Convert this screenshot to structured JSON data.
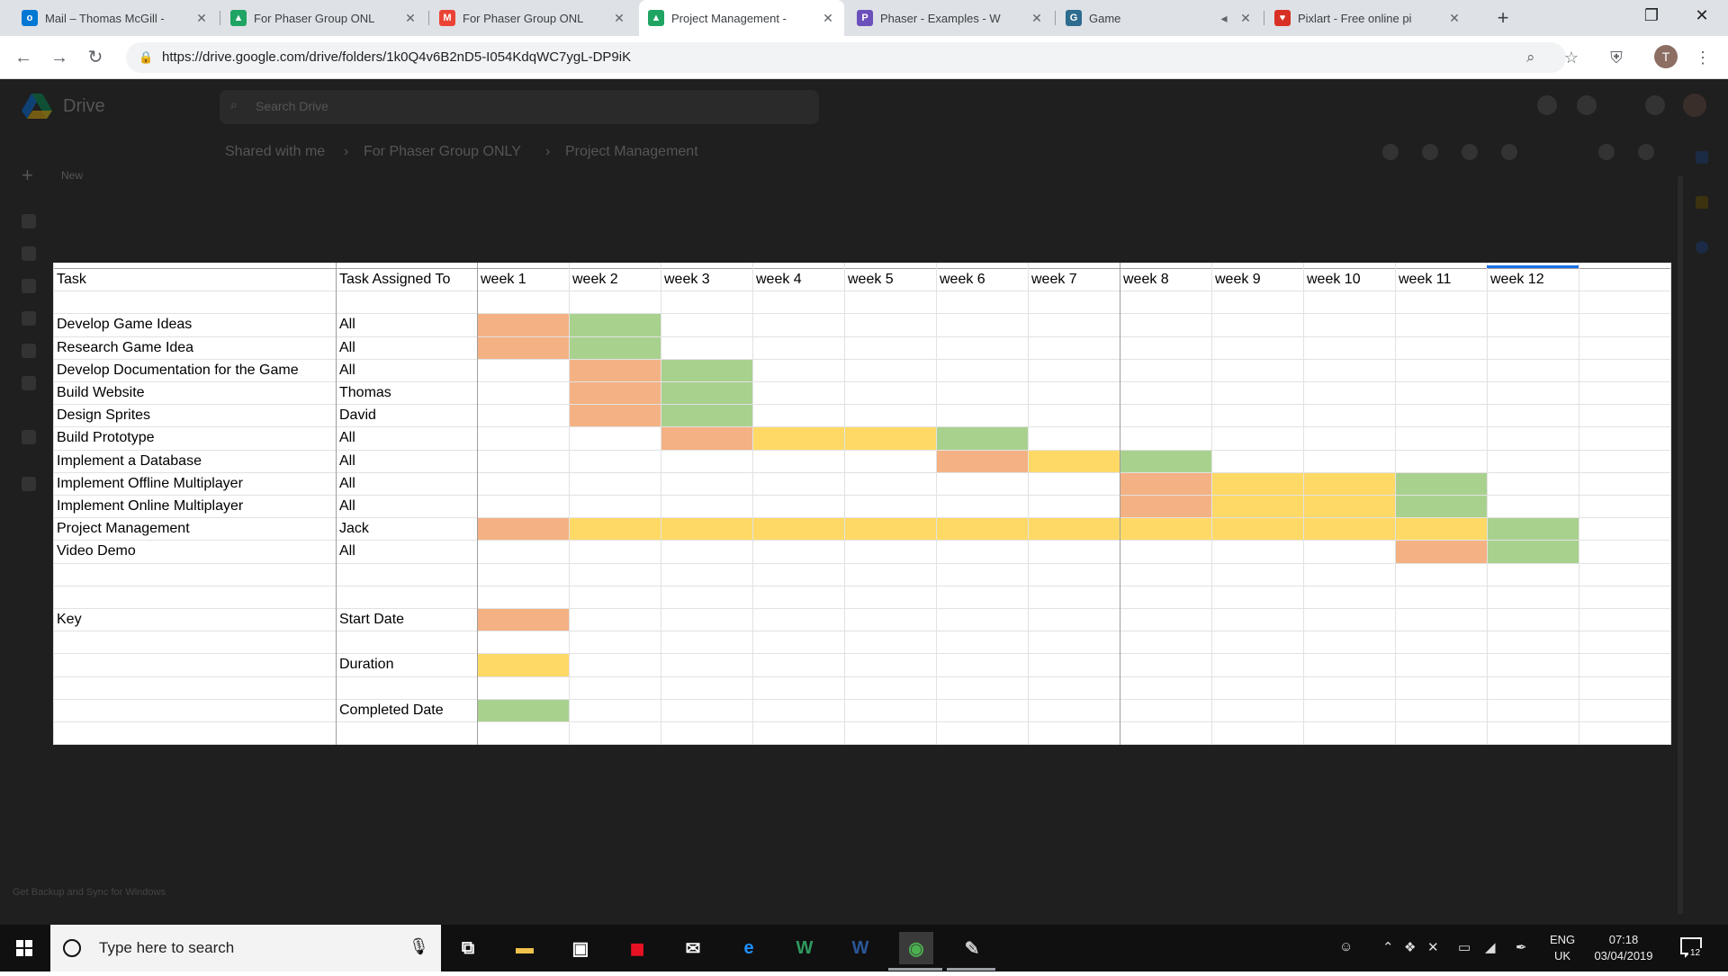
{
  "browser": {
    "tabs": [
      {
        "title": "Mail – Thomas McGill - ",
        "favicon": "outlook-icon",
        "color": "#0078d4",
        "glyph": "o"
      },
      {
        "title": "For Phaser Group ONL",
        "favicon": "google-drive-icon",
        "color": "#1fa463",
        "glyph": "▲"
      },
      {
        "title": "For Phaser Group ONL",
        "favicon": "gmail-icon",
        "color": "#ea4335",
        "glyph": "M"
      },
      {
        "title": "Project Management - ",
        "favicon": "google-drive-icon",
        "color": "#1fa463",
        "glyph": "▲"
      },
      {
        "title": "Phaser - Examples - W",
        "favicon": "phaser-icon",
        "color": "#6b4fbb",
        "glyph": "P"
      },
      {
        "title": "Game",
        "favicon": "game-icon",
        "color": "#2d6b8f",
        "glyph": "G"
      },
      {
        "title": "Pixlart - Free online pi",
        "favicon": "heart-icon",
        "color": "#d93025",
        "glyph": "♥"
      }
    ],
    "url": "https://drive.google.com/drive/folders/1k0Q4v6B2nD5-I054KdqWC7ygL-DP9iK",
    "profile_initial": "T"
  },
  "drive": {
    "app_name": "Drive",
    "search_placeholder": "Search Drive",
    "breadcrumb": [
      "Shared with me",
      "For Phaser Group ONLY",
      "Project Management"
    ],
    "new_label": "New",
    "footer": "Get Backup and Sync for Windows"
  },
  "sheet": {
    "header": {
      "task": "Task",
      "assigned": "Task Assigned To",
      "weeks": [
        "week 1",
        "week 2",
        "week 3",
        "week 4",
        "week 5",
        "week 6",
        "week 7",
        "week 8",
        "week 9",
        "week 10",
        "week 11",
        "week 12"
      ]
    },
    "tasks": [
      {
        "name": "Develop Game Ideas",
        "assigned": "All",
        "start": 1,
        "duration": [],
        "completed": 2
      },
      {
        "name": "Research Game Idea",
        "assigned": "All",
        "start": 1,
        "duration": [],
        "completed": 2
      },
      {
        "name": "Develop Documentation for the Game",
        "assigned": "All",
        "start": 2,
        "duration": [],
        "completed": 3
      },
      {
        "name": "Build Website",
        "assigned": "Thomas",
        "start": 2,
        "duration": [],
        "completed": 3
      },
      {
        "name": "Design Sprites",
        "assigned": "David",
        "start": 2,
        "duration": [],
        "completed": 3
      },
      {
        "name": "Build Prototype",
        "assigned": "All",
        "start": 3,
        "duration": [
          4,
          5
        ],
        "completed": 6
      },
      {
        "name": "Implement a Database",
        "assigned": "All",
        "start": 6,
        "duration": [
          7
        ],
        "completed": 8
      },
      {
        "name": "Implement Offline Multiplayer",
        "assigned": "All",
        "start": 8,
        "duration": [
          9,
          10
        ],
        "completed": 11
      },
      {
        "name": "Implement Online Multiplayer",
        "assigned": "All",
        "start": 8,
        "duration": [
          9,
          10
        ],
        "completed": 11
      },
      {
        "name": "Project Management",
        "assigned": "Jack",
        "start": 1,
        "duration": [
          2,
          3,
          4,
          5,
          6,
          7,
          8,
          9,
          10,
          11
        ],
        "completed": 12
      },
      {
        "name": "Video Demo",
        "assigned": "All",
        "start": 11,
        "duration": [],
        "completed": 12
      }
    ],
    "key": {
      "title": "Key",
      "items": [
        {
          "label": "Start Date",
          "kind": "start"
        },
        {
          "label": "Duration",
          "kind": "duration"
        },
        {
          "label": "Completed Date",
          "kind": "completed"
        }
      ]
    },
    "colors": {
      "start": "#f4b183",
      "duration": "#ffd966",
      "completed": "#a9d18e"
    }
  },
  "taskbar": {
    "search_placeholder": "Type here to search",
    "language": [
      "ENG",
      "UK"
    ],
    "time": "07:18",
    "date": "03/04/2019",
    "notification_count": "12"
  }
}
